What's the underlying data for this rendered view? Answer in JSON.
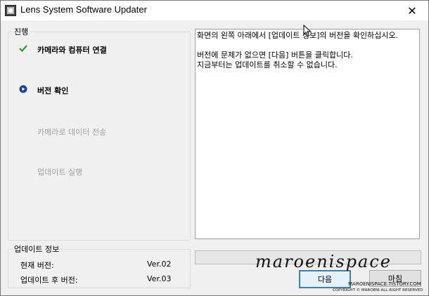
{
  "window": {
    "title": "Lens System Software Updater",
    "close_glyph": "✕"
  },
  "progress": {
    "legend": "진행",
    "steps": [
      {
        "label": "카메라와 컴퓨터 연결",
        "state": "done",
        "icon": "checkmark-icon"
      },
      {
        "label": "버전 확인",
        "state": "current",
        "icon": "play-circle-icon"
      },
      {
        "label": "카메라로 데이터 전송",
        "state": "pending"
      },
      {
        "label": "업데이트 실행",
        "state": "pending"
      }
    ]
  },
  "message": {
    "line1": "화면의 왼쪽 아래에서 [업데이트 정보]의 버전을 확인하십시오.",
    "line2": "버전에 문제가 없으면 [다음] 버튼을 클릭합니다.",
    "line3": "지금부터는 업데이트를 취소할 수 없습니다."
  },
  "update_info": {
    "legend": "업데이트 정보",
    "current_label": "현재 버전:",
    "current_value": "Ver.02",
    "after_label": "업데이트 후 버전:",
    "after_value": "Ver.03"
  },
  "progress_bar": {
    "fraction": 0.0
  },
  "buttons": {
    "next": "다음",
    "finish": "마침"
  },
  "watermark": {
    "script": "maroenispace",
    "url": "MAROENISPACE.TISTORY.COM",
    "copyright": "COPYRIGHT © MAROENI ALL RIGHT RESERVED"
  },
  "colors": {
    "accent": "#1f6fbf",
    "check": "#2e9a2e"
  }
}
